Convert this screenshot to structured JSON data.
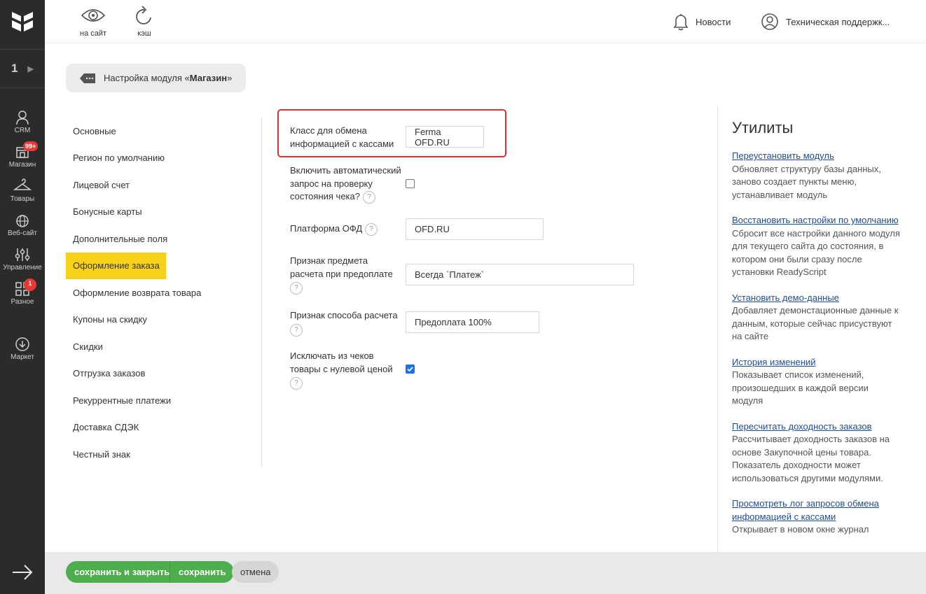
{
  "rail": {
    "site_number": "1",
    "items": [
      {
        "label": "CRM",
        "icon": "crm-icon"
      },
      {
        "label": "Магазин",
        "icon": "store-icon",
        "badge": "99+"
      },
      {
        "label": "Товары",
        "icon": "hanger-icon"
      },
      {
        "label": "Веб-сайт",
        "icon": "globe-icon"
      },
      {
        "label": "Управление",
        "icon": "sliders-icon"
      },
      {
        "label": "Разное",
        "icon": "grid-icon",
        "badge": "1"
      },
      {
        "label": "Маркет",
        "icon": "download-icon"
      }
    ]
  },
  "topbar": {
    "to_site": "на сайт",
    "cache": "кэш",
    "news": "Новости",
    "support": "Техническая поддержк..."
  },
  "module_title": {
    "prefix": "Настройка модуля «",
    "name": "Магазин",
    "suffix": "»"
  },
  "tabs": [
    "Основные",
    "Регион по умолчанию",
    "Лицевой счет",
    "Бонусные карты",
    "Дополнительные поля",
    "Оформление заказа",
    "Оформление возврата товара",
    "Купоны на скидку",
    "Скидки",
    "Отгрузка заказов",
    "Рекуррентные платежи",
    "Доставка СДЭК",
    "Честный знак"
  ],
  "active_tab": "Оформление заказа",
  "form": {
    "exchange_class_label_1": "Класс для обмена",
    "exchange_class_label_2": "информацией с кассами",
    "exchange_class_value": "Ferma OFD.RU",
    "auto_check_label_1": "Включить автоматический",
    "auto_check_label_2": "запрос на проверку",
    "auto_check_label_3": "состояния чека?",
    "ofd_platform_label": "Платформа ОФД",
    "ofd_platform_value": "OFD.RU",
    "prepay_subject_label_1": "Признак предмета",
    "prepay_subject_label_2": "расчета при предоплате",
    "prepay_subject_value": "Всегда `Платеж`",
    "payment_method_label": "Признак способа расчета",
    "payment_method_value": "Предоплата 100%",
    "exclude_zero_label_1": "Исключать из чеков",
    "exclude_zero_label_2": "товары с нулевой ценой",
    "help": "?"
  },
  "utilities": {
    "title": "Утилиты",
    "items": [
      {
        "link": "Переустановить модуль",
        "desc": "Обновляет структуру базы данных, заново создает пункты меню, устанавливает модуль"
      },
      {
        "link": "Восстановить настройки по умолчанию",
        "desc": "Сбросит все настройки данного модуля для текущего сайта до состояния, в котором они были сразу после установки ReadyScript"
      },
      {
        "link": "Установить демо-данные",
        "desc": "Добавляет демонстационные данные к данным, которые сейчас присуствуют на сайте"
      },
      {
        "link": "История изменений",
        "desc": "Показывает список изменений, произошедших в каждой версии модуля"
      },
      {
        "link": "Пересчитать доходность заказов",
        "desc": "Рассчитывает доходность заказов на основе Закупочной цены товара. Показатель доходности может использоваться другими модулями."
      },
      {
        "link": "Просмотреть лог запросов обмена информацией с кассами",
        "desc": "Открывает в новом окне журнал"
      }
    ]
  },
  "bottom": {
    "save_close": "сохранить и закрыть",
    "save": "сохранить",
    "cancel": "отмена"
  },
  "colors": {
    "rail_bg": "#2b2b2b",
    "active_tab": "#f7d21b",
    "save_green": "#4cae4c",
    "highlight_red": "#e0312f",
    "link_blue": "#1f4e96"
  }
}
